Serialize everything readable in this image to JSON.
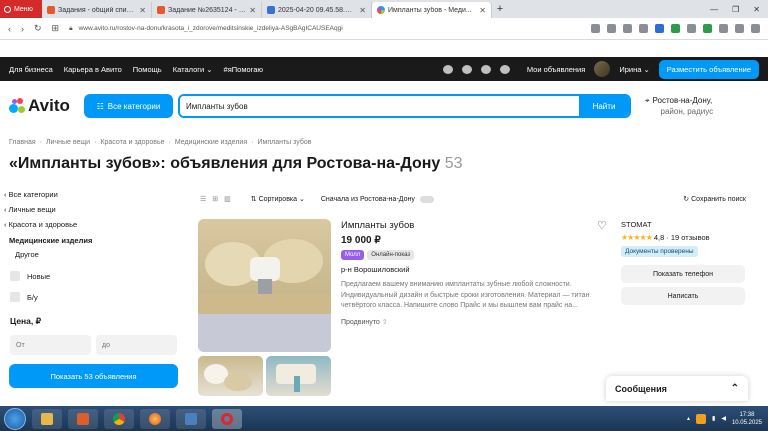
{
  "browser": {
    "menu_label": "Меню",
    "tabs": [
      {
        "label": "Задания - общий список ..."
      },
      {
        "label": "Задание №2635124 - про..."
      },
      {
        "label": "2025-04-20 09.45.58.PNG..."
      },
      {
        "label": "Импланты зубов - Меди..."
      }
    ],
    "new_tab": "+",
    "url": "www.avito.ru/rostov-na-donu/krasota_i_zdorove/meditsinskie_izdeliya-ASgBAgICAUSEAqgi"
  },
  "topnav": {
    "items": [
      "Для бизнеса",
      "Карьера в Авито",
      "Помощь",
      "Каталоги ⌄",
      "#яПомогаю"
    ],
    "my_ads": "Мои объявления",
    "user": "Ирина ⌄",
    "post_button": "Разместить объявление"
  },
  "header": {
    "logo": "Avito",
    "categories_button": "Все категории",
    "search_value": "Импланты зубов",
    "search_button": "Найти",
    "location_line1": "Ростов-на-Дону,",
    "location_line2": "район, радиус"
  },
  "breadcrumbs": [
    "Главная",
    "Личные вещи",
    "Красота и здоровье",
    "Медицинские изделия",
    "Импланты зубов"
  ],
  "page_title": "«Импланты зубов»: объявления для Ростова-на-Дону",
  "result_count": "53",
  "sidebar": {
    "back_links": [
      "Все категории",
      "Личные вещи",
      "Красота и здоровье"
    ],
    "current": "Медицинские изделия",
    "other": "Другое",
    "checkboxes": [
      "Новые",
      "Б/у"
    ],
    "price_label": "Цена, ₽",
    "price_from": "От",
    "price_to": "до",
    "show_button": "Показать 53 объявления"
  },
  "toolbar": {
    "sort": "Сортировка",
    "toggle_label": "Сначала из Ростова-на-Дону",
    "save_search": "Сохранить поиск"
  },
  "listing": {
    "title": "Импланты зубов",
    "price": "19 000 ₽",
    "badge_mall": "Молл",
    "badge_online": "Онлайн-показ",
    "district": "р-н Ворошиловский",
    "description": "Предлагаем вашему вниманию имплантаты зубные любой сложности. Индивидуальный дизайн и быстрые сроки изготовления. Материал — титан четвёртого класса. Напишите слово Прайс и мы вышлем вам прайс на...",
    "more": "Продвинуто"
  },
  "seller": {
    "name": "STOMAT",
    "stars": "★★★★★",
    "rating": "4,8",
    "reviews": "· 19 отзывов",
    "docs_badge": "Документы проверены",
    "phone_button": "Показать телефон",
    "write_button": "Написать"
  },
  "messages": {
    "title": "Сообщения"
  },
  "taskbar": {
    "time": "17:38",
    "date": "10.05.2025"
  },
  "colors": {
    "accent": "#0099f7",
    "dark_nav": "#1a1a1a",
    "mall_badge": "#965eeb"
  }
}
